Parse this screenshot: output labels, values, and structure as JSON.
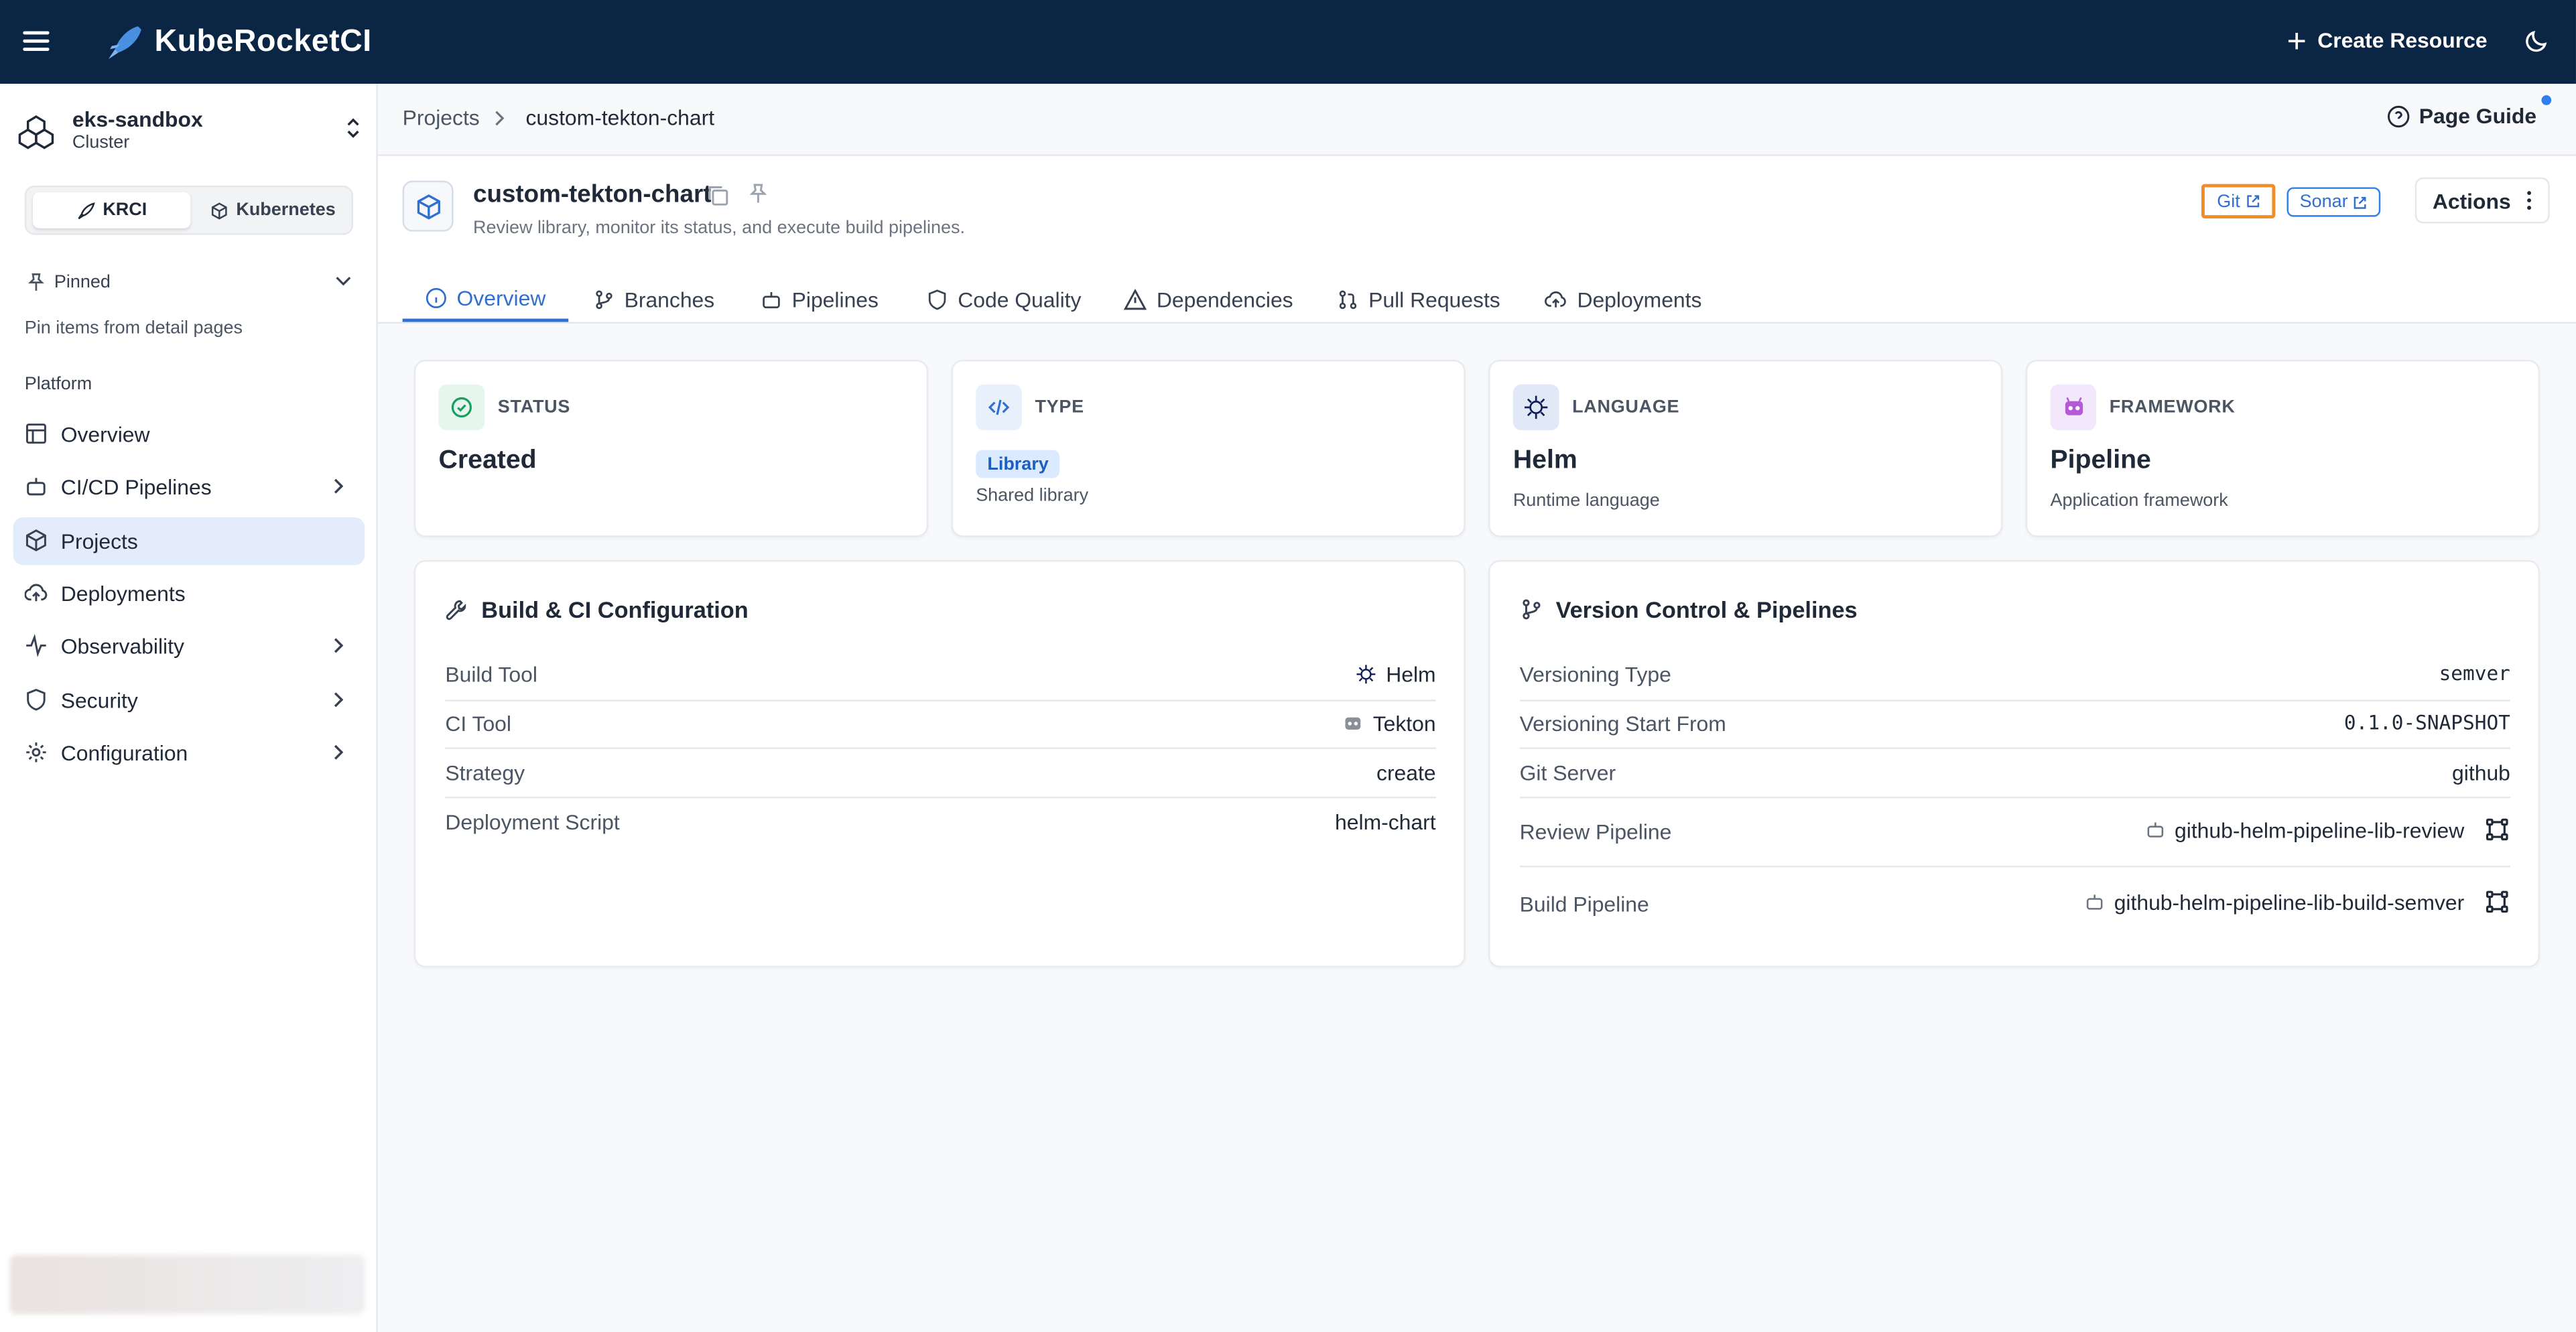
{
  "app": {
    "title": "KubeRocketCI"
  },
  "topbar": {
    "create_label": "Create Resource"
  },
  "cluster": {
    "name": "eks-sandbox",
    "subtitle": "Cluster"
  },
  "switcher": {
    "krci": "KRCI",
    "kubernetes": "Kubernetes"
  },
  "pinned": {
    "label": "Pinned",
    "hint": "Pin items from detail pages"
  },
  "platform_label": "Platform",
  "nav": [
    {
      "label": "Overview",
      "icon": "overview-icon"
    },
    {
      "label": "CI/CD Pipelines",
      "icon": "robot-icon"
    },
    {
      "label": "Projects",
      "icon": "cube-icon"
    },
    {
      "label": "Deployments",
      "icon": "cloud-upload-icon"
    },
    {
      "label": "Observability",
      "icon": "activity-icon"
    },
    {
      "label": "Security",
      "icon": "shield-icon"
    },
    {
      "label": "Configuration",
      "icon": "gear-icon"
    }
  ],
  "breadcrumb": {
    "parent": "Projects",
    "current": "custom-tekton-chart"
  },
  "page_guide": "Page Guide",
  "project": {
    "name": "custom-tekton-chart",
    "description": "Review library, monitor its status, and execute build pipelines.",
    "git_label": "Git",
    "sonar_label": "Sonar",
    "actions_label": "Actions"
  },
  "tabs": [
    "Overview",
    "Branches",
    "Pipelines",
    "Code Quality",
    "Dependencies",
    "Pull Requests",
    "Deployments"
  ],
  "cards": {
    "status": {
      "label": "STATUS",
      "value": "Created"
    },
    "type": {
      "label": "TYPE",
      "badge": "Library",
      "sub": "Shared library"
    },
    "language": {
      "label": "LANGUAGE",
      "value": "Helm",
      "sub": "Runtime language"
    },
    "framework": {
      "label": "FRAMEWORK",
      "value": "Pipeline",
      "sub": "Application framework"
    }
  },
  "build": {
    "title": "Build & CI Configuration",
    "rows": [
      {
        "k": "Build Tool",
        "v": "Helm"
      },
      {
        "k": "CI Tool",
        "v": "Tekton"
      },
      {
        "k": "Strategy",
        "v": "create"
      },
      {
        "k": "Deployment Script",
        "v": "helm-chart"
      }
    ]
  },
  "vcs": {
    "title": "Version Control & Pipelines",
    "rows": [
      {
        "k": "Versioning Type",
        "v": "semver"
      },
      {
        "k": "Versioning Start From",
        "v": "0.1.0-SNAPSHOT"
      },
      {
        "k": "Git Server",
        "v": "github"
      },
      {
        "k": "Review Pipeline",
        "v": "github-helm-pipeline-lib-review"
      },
      {
        "k": "Build Pipeline",
        "v": "github-helm-pipeline-lib-build-semver"
      }
    ]
  },
  "colors": {
    "topbar": "#0b2545",
    "accent": "#2f6fd1",
    "highlight": "#f28c28"
  }
}
